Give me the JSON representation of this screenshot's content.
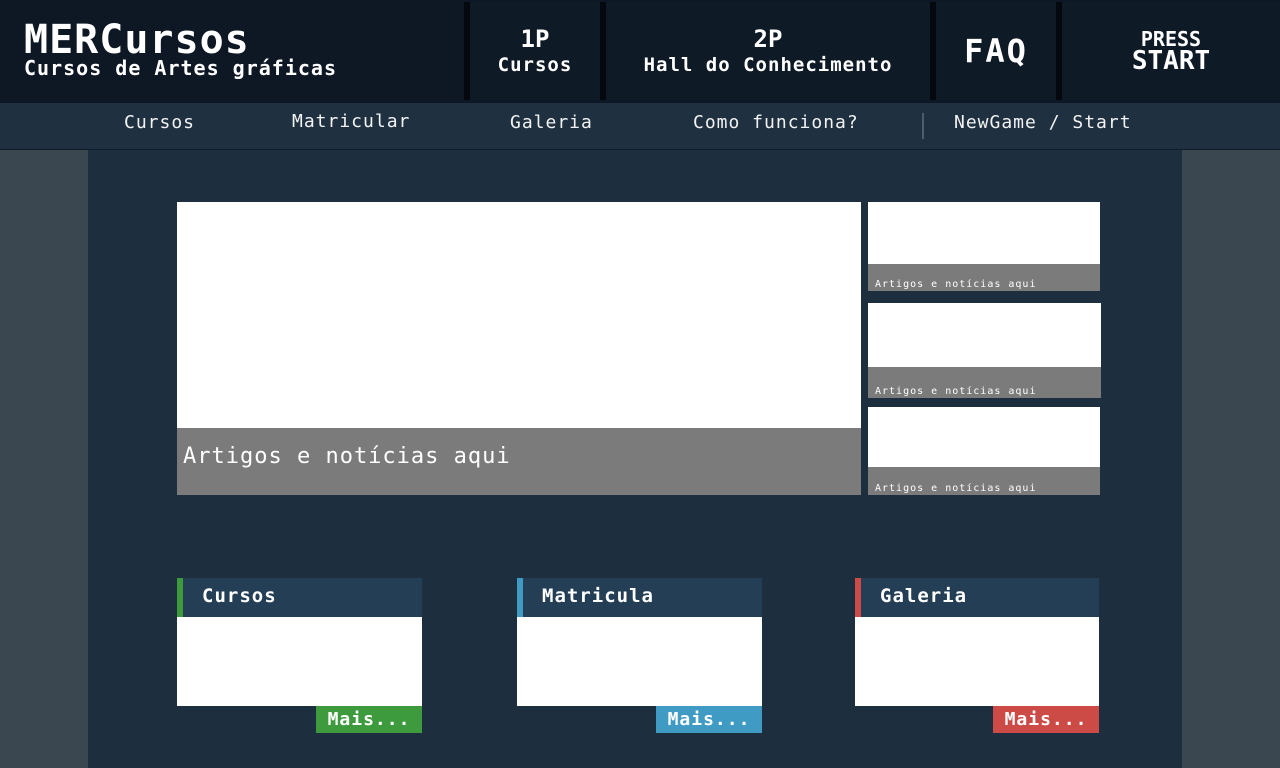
{
  "header": {
    "brand_title": "MERCursos",
    "brand_subtitle": "Cursos de Artes gráficas",
    "btn_1p_top": "1P",
    "btn_1p_bottom": "Cursos",
    "btn_2p_top": "2P",
    "btn_2p_bottom": "Hall do Conhecimento",
    "btn_faq": "FAQ",
    "btn_press_top": "PRESS",
    "btn_press_bottom": "START"
  },
  "nav": {
    "items": [
      "Cursos",
      "Matricular",
      "Galeria",
      "Como funciona?",
      "NewGame / Start"
    ]
  },
  "featured": {
    "main_caption": "Artigos e notícias aqui",
    "side_captions": [
      "Artigos e notícias aqui",
      "Artigos e notícias aqui",
      "Artigos e notícias aqui"
    ]
  },
  "cards": [
    {
      "title": "Cursos",
      "more": "Mais...",
      "accent": "#3d9b3d"
    },
    {
      "title": "Matricula",
      "more": "Mais...",
      "accent": "#3f9bc4"
    },
    {
      "title": "Galeria",
      "more": "Mais...",
      "accent": "#cc4b47"
    }
  ],
  "colors": {
    "header_bg": "#0e1824",
    "nav_bg": "#1f3140",
    "main_bg": "#1d2f3e",
    "page_bg": "#3a4650",
    "caption_bg": "#7b7b7b"
  }
}
